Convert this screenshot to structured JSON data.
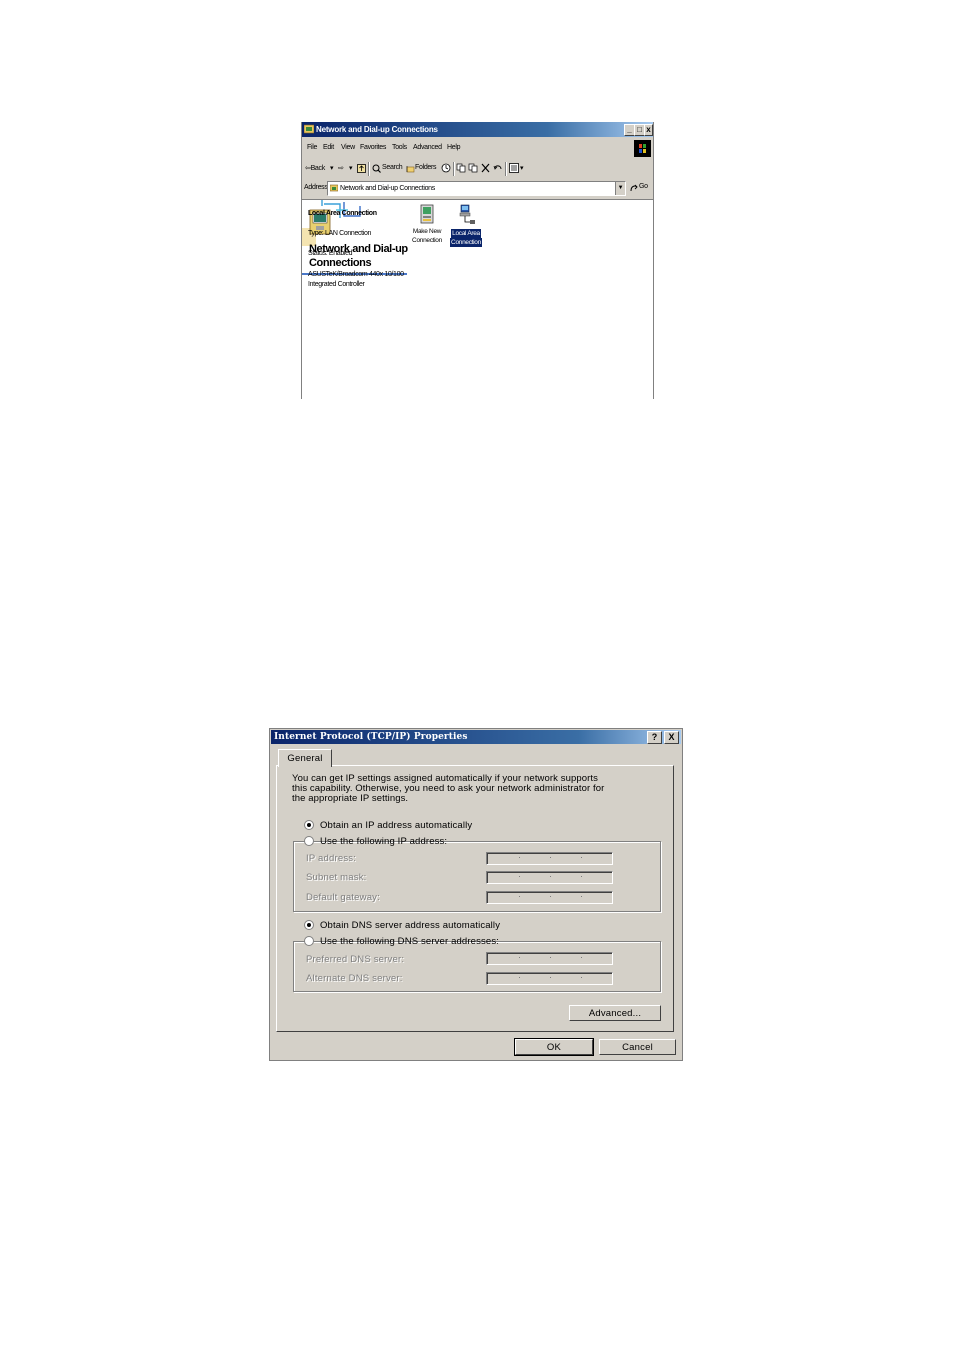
{
  "explorer": {
    "title": "Network and Dial-up Connections",
    "window_buttons": {
      "minimize": "_",
      "maximize": "□",
      "close": "x"
    },
    "menu": [
      "File",
      "Edit",
      "View",
      "Favorites",
      "Tools",
      "Advanced",
      "Help"
    ],
    "toolbar": {
      "back": "⇦Back",
      "back_drop": "▾",
      "forward": "⇨",
      "forward_drop": "▾",
      "search": "Search",
      "folders": "Folders"
    },
    "address": {
      "label": "Address",
      "value": "Network and Dial-up Connections",
      "go": "Go"
    },
    "panel": {
      "title_line1": "Network and Dial-up",
      "title_line2": "Connections",
      "selected_name": "Local Area Connection",
      "type": "Type: LAN Connection",
      "status": "Status: Enabled",
      "device_line1": "ASUSTeK/Broadcom 440x 10/100",
      "device_line2": "Integrated Controller"
    },
    "icons": [
      {
        "line1": "Make New",
        "line2": "Connection",
        "icon": "make-new-connection-icon"
      },
      {
        "line1": "Local Area",
        "line2": "Connection",
        "icon": "local-area-connection-icon"
      }
    ]
  },
  "dialog": {
    "title": "Internet Protocol (TCP/IP) Properties",
    "help_button": "?",
    "close_button": "X",
    "tab": "General",
    "intro_line1": "You can get IP settings assigned automatically if your network supports",
    "intro_line2": "this capability. Otherwise, you need to ask your network administrator for",
    "intro_line3": "the appropriate IP settings.",
    "ip_auto": "Obtain an IP address automatically",
    "ip_manual": "Use the following IP address:",
    "ip_address": "IP address:",
    "subnet_mask": "Subnet mask:",
    "default_gateway": "Default gateway:",
    "dns_auto": "Obtain DNS server address automatically",
    "dns_manual": "Use the following DNS server addresses:",
    "preferred_dns": "Preferred DNS server:",
    "alternate_dns": "Alternate DNS server:",
    "advanced_button": "Advanced...",
    "ok_button": "OK",
    "cancel_button": "Cancel"
  },
  "colors": {
    "titlebar_start": "#0a246a",
    "titlebar_end": "#a6caf0",
    "window_face": "#d4d0c8",
    "selection": "#0a246a"
  }
}
